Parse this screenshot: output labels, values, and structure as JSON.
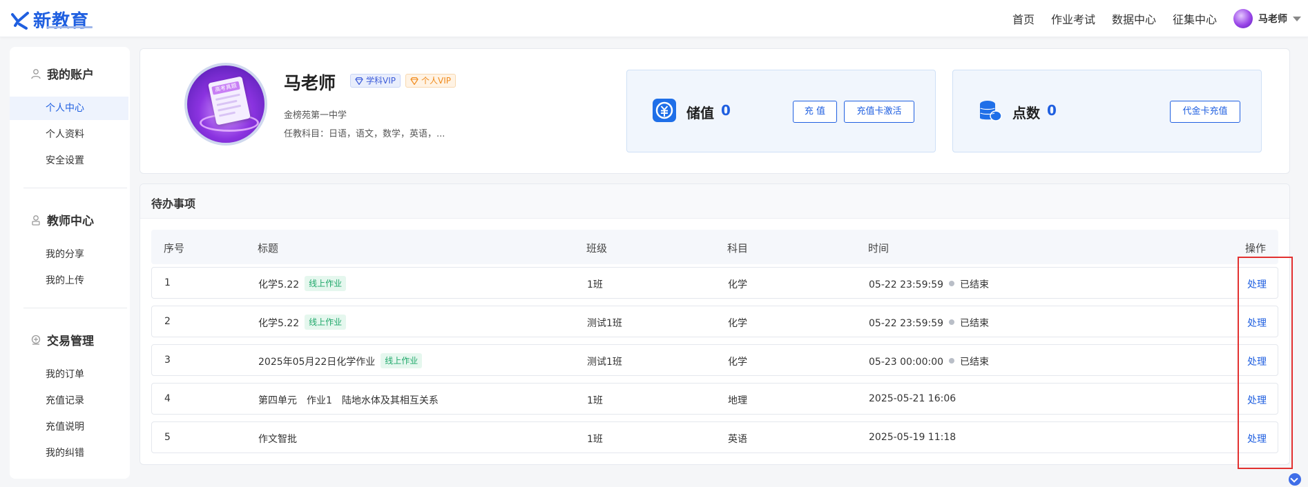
{
  "header": {
    "logo_text": "新教育",
    "nav": [
      "首页",
      "作业考试",
      "数据中心",
      "征集中心"
    ],
    "user_name": "马老师"
  },
  "sidebar": {
    "groups": [
      {
        "title": "我的账户",
        "items": [
          "个人中心",
          "个人资料",
          "安全设置"
        ]
      },
      {
        "title": "教师中心",
        "items": [
          "我的分享",
          "我的上传"
        ]
      },
      {
        "title": "交易管理",
        "items": [
          "我的订单",
          "充值记录",
          "充值说明",
          "我的纠错"
        ]
      }
    ],
    "active_item": "个人中心"
  },
  "profile": {
    "avatar_text": "高考真题",
    "name": "马老师",
    "badge_subject": "学科VIP",
    "badge_personal": "个人VIP",
    "school": "金榜苑第一中学",
    "subjects": "任教科目：日语，语文，数学，英语，..."
  },
  "stored_value": {
    "label": "储值",
    "value": "0",
    "btn_recharge": "充 值",
    "btn_card": "充值卡激活"
  },
  "points": {
    "label": "点数",
    "value": "0",
    "btn_voucher": "代金卡充值"
  },
  "todo": {
    "title": "待办事项",
    "columns": [
      "序号",
      "标题",
      "班级",
      "科目",
      "时间",
      "操作"
    ],
    "rows": [
      {
        "no": "1",
        "title": "化学5.22",
        "tag": "线上作业",
        "class": "1班",
        "subject": "化学",
        "time": "05-22 23:59:59",
        "status": "已结束",
        "action": "处理"
      },
      {
        "no": "2",
        "title": "化学5.22",
        "tag": "线上作业",
        "class": "测试1班",
        "subject": "化学",
        "time": "05-22 23:59:59",
        "status": "已结束",
        "action": "处理"
      },
      {
        "no": "3",
        "title": "2025年05月22日化学作业",
        "tag": "线上作业",
        "class": "测试1班",
        "subject": "化学",
        "time": "05-23 00:00:00",
        "status": "已结束",
        "action": "处理"
      },
      {
        "no": "4",
        "title": "第四单元　作业1　陆地水体及其相互关系",
        "tag": "",
        "class": "1班",
        "subject": "地理",
        "time": "2025-05-21 16:06",
        "status": "",
        "action": "处理"
      },
      {
        "no": "5",
        "title": "作文智批",
        "tag": "",
        "class": "1班",
        "subject": "英语",
        "time": "2025-05-19 11:18",
        "status": "",
        "action": "处理"
      }
    ]
  },
  "colors": {
    "primary": "#1f5fe0",
    "tag_green": "#1fa86a",
    "highlight_red": "#e2302f"
  }
}
